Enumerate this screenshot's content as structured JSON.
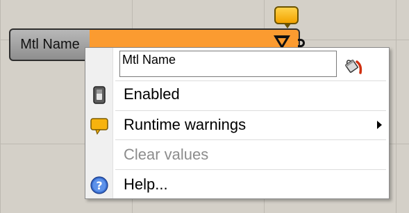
{
  "component": {
    "label": "Mtl Name",
    "body_color": "#fb9b30",
    "warning_balloon_color": "#f7b30e"
  },
  "menu": {
    "name_field": {
      "value": "Mtl Name"
    },
    "paint_icon": "paint-bucket-icon",
    "items": [
      {
        "label": "Enabled",
        "icon": "toggle-switch-icon",
        "enabled": true
      },
      {
        "label": "Runtime warnings",
        "icon": "warning-balloon-icon",
        "submenu": true,
        "enabled": true
      },
      {
        "label": "Clear values",
        "enabled": false
      },
      {
        "label": "Help...",
        "icon": "help-icon",
        "enabled": true
      }
    ]
  }
}
